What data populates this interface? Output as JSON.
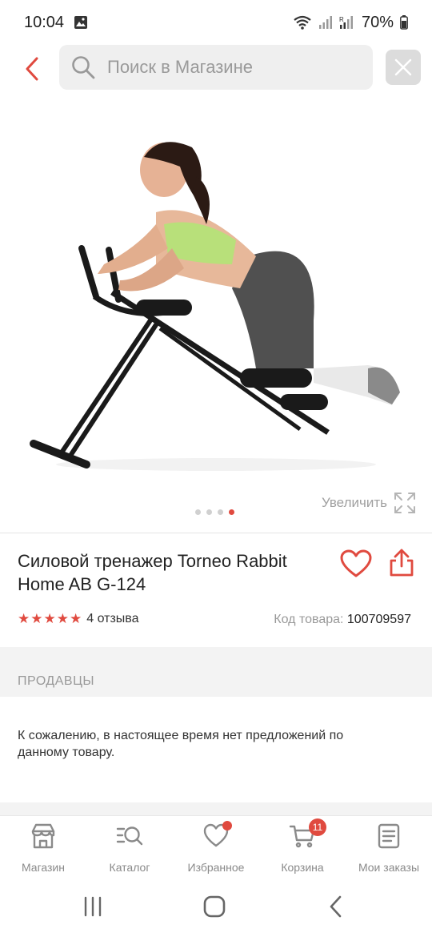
{
  "status": {
    "time": "10:04",
    "battery": "70%"
  },
  "search": {
    "placeholder": "Поиск в Магазине"
  },
  "gallery": {
    "zoom_label": "Увеличить",
    "dots_count": 4,
    "active_dot": 4
  },
  "product": {
    "title": "Силовой тренажер Torneo Rabbit Home AB G-124",
    "rating_stars": 5,
    "reviews": "4 отзыва",
    "code_label": "Код товара:",
    "code_value": "100709597"
  },
  "sellers": {
    "title": "ПРОДАВЦЫ",
    "message": "К сожалению, в настоящее время нет предложений по данному товару."
  },
  "nav": {
    "items": [
      {
        "label": "Магазин",
        "icon": "store-icon"
      },
      {
        "label": "Каталог",
        "icon": "catalog-search-icon"
      },
      {
        "label": "Избранное",
        "icon": "heart-icon"
      },
      {
        "label": "Корзина",
        "icon": "cart-icon"
      },
      {
        "label": "Мои заказы",
        "icon": "orders-icon"
      }
    ],
    "cart_badge": "11"
  },
  "colors": {
    "accent": "#e04a3f"
  }
}
